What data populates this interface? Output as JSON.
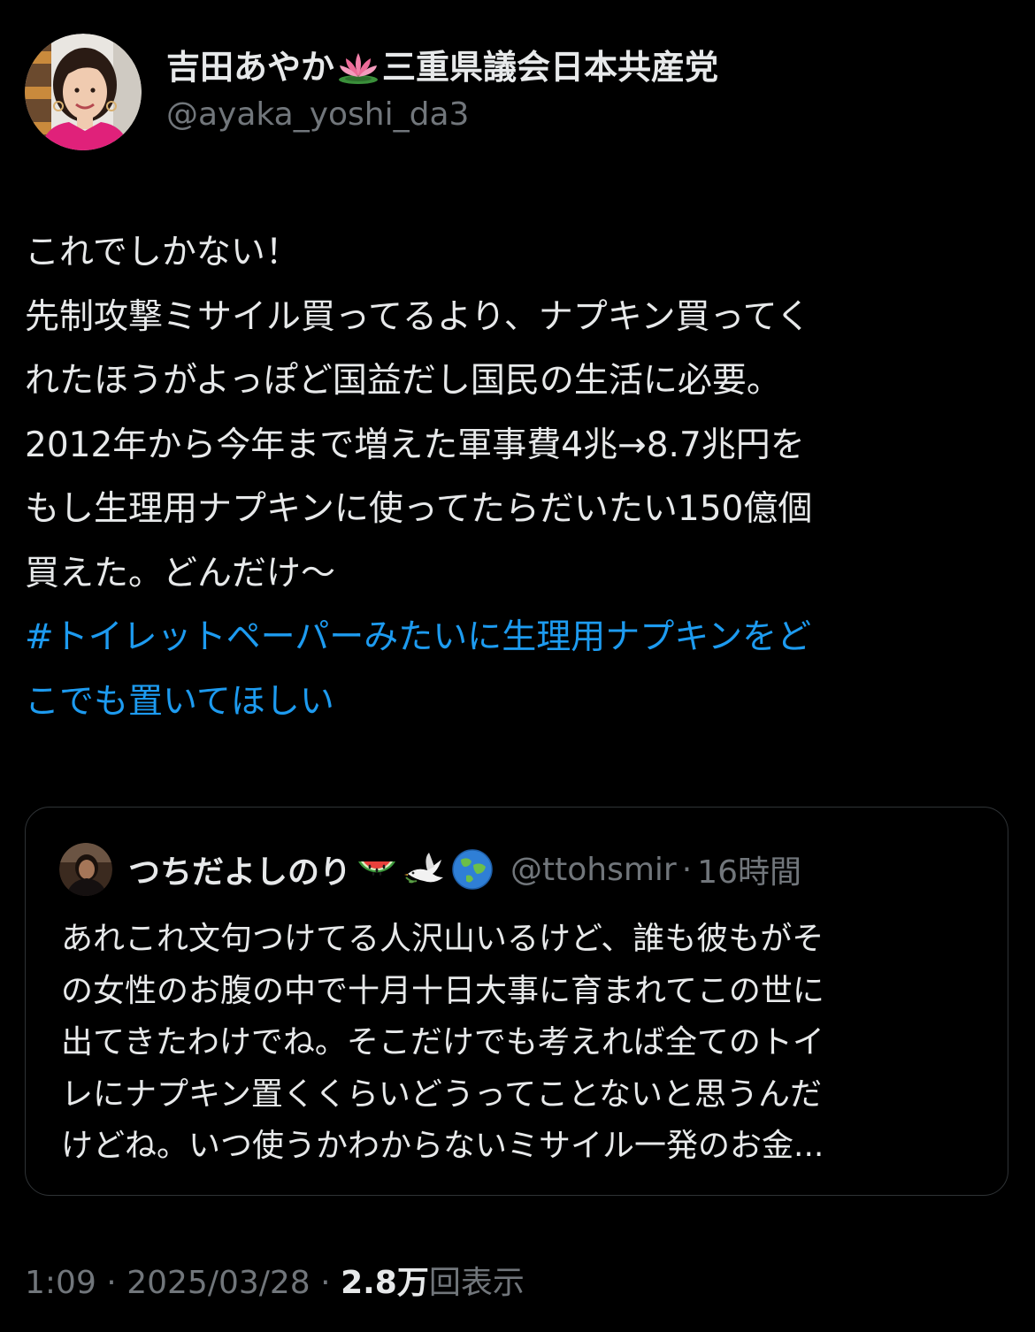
{
  "author": {
    "display_name_before": "吉田あやか",
    "display_name_emoji": "lotus-icon",
    "display_name_after": "三重県議会日本共産党",
    "handle": "@ayaka_yoshi_da3"
  },
  "tweet": {
    "lines": [
      "これでしかない！",
      "先制攻撃ミサイル買ってるより、ナプキン買ってく",
      "れたほうがよっぽど国益だし国民の生活に必要。",
      "2012年から今年まで増えた軍事費4兆→8.7兆円を",
      "もし生理用ナプキンに使ってたらだいたい150億個",
      "買えた。どんだけ〜"
    ],
    "hashtag_lines": [
      "#トイレットペーパーみたいに生理用ナプキンをど",
      "こでも置いてほしい"
    ]
  },
  "quote": {
    "display_name": "つちだよしのり",
    "emojis": [
      "watermelon-icon",
      "dove-icon",
      "globe-icon"
    ],
    "handle": "@ttohsmir",
    "separator": "·",
    "time": "16時間",
    "lines": [
      "あれこれ文句つけてる人沢山いるけど、誰も彼もがそ",
      "の女性のお腹の中で十月十日大事に育まれてこの世に",
      "出てきたわけでね。そこだけでも考えれば全てのトイ",
      "レにナプキン置くくらいどうってことないと思うんだ",
      "けどね。いつ使うかわからないミサイル一発のお金..."
    ]
  },
  "meta": {
    "time": "1:09",
    "separator": "·",
    "date": "2025/03/28",
    "views_count": "2.8万",
    "views_label": "回表示"
  },
  "colors": {
    "background": "#000000",
    "text_primary": "#e7e9ea",
    "text_secondary": "#71767b",
    "link": "#1d9bf0",
    "border": "#2f3336"
  }
}
